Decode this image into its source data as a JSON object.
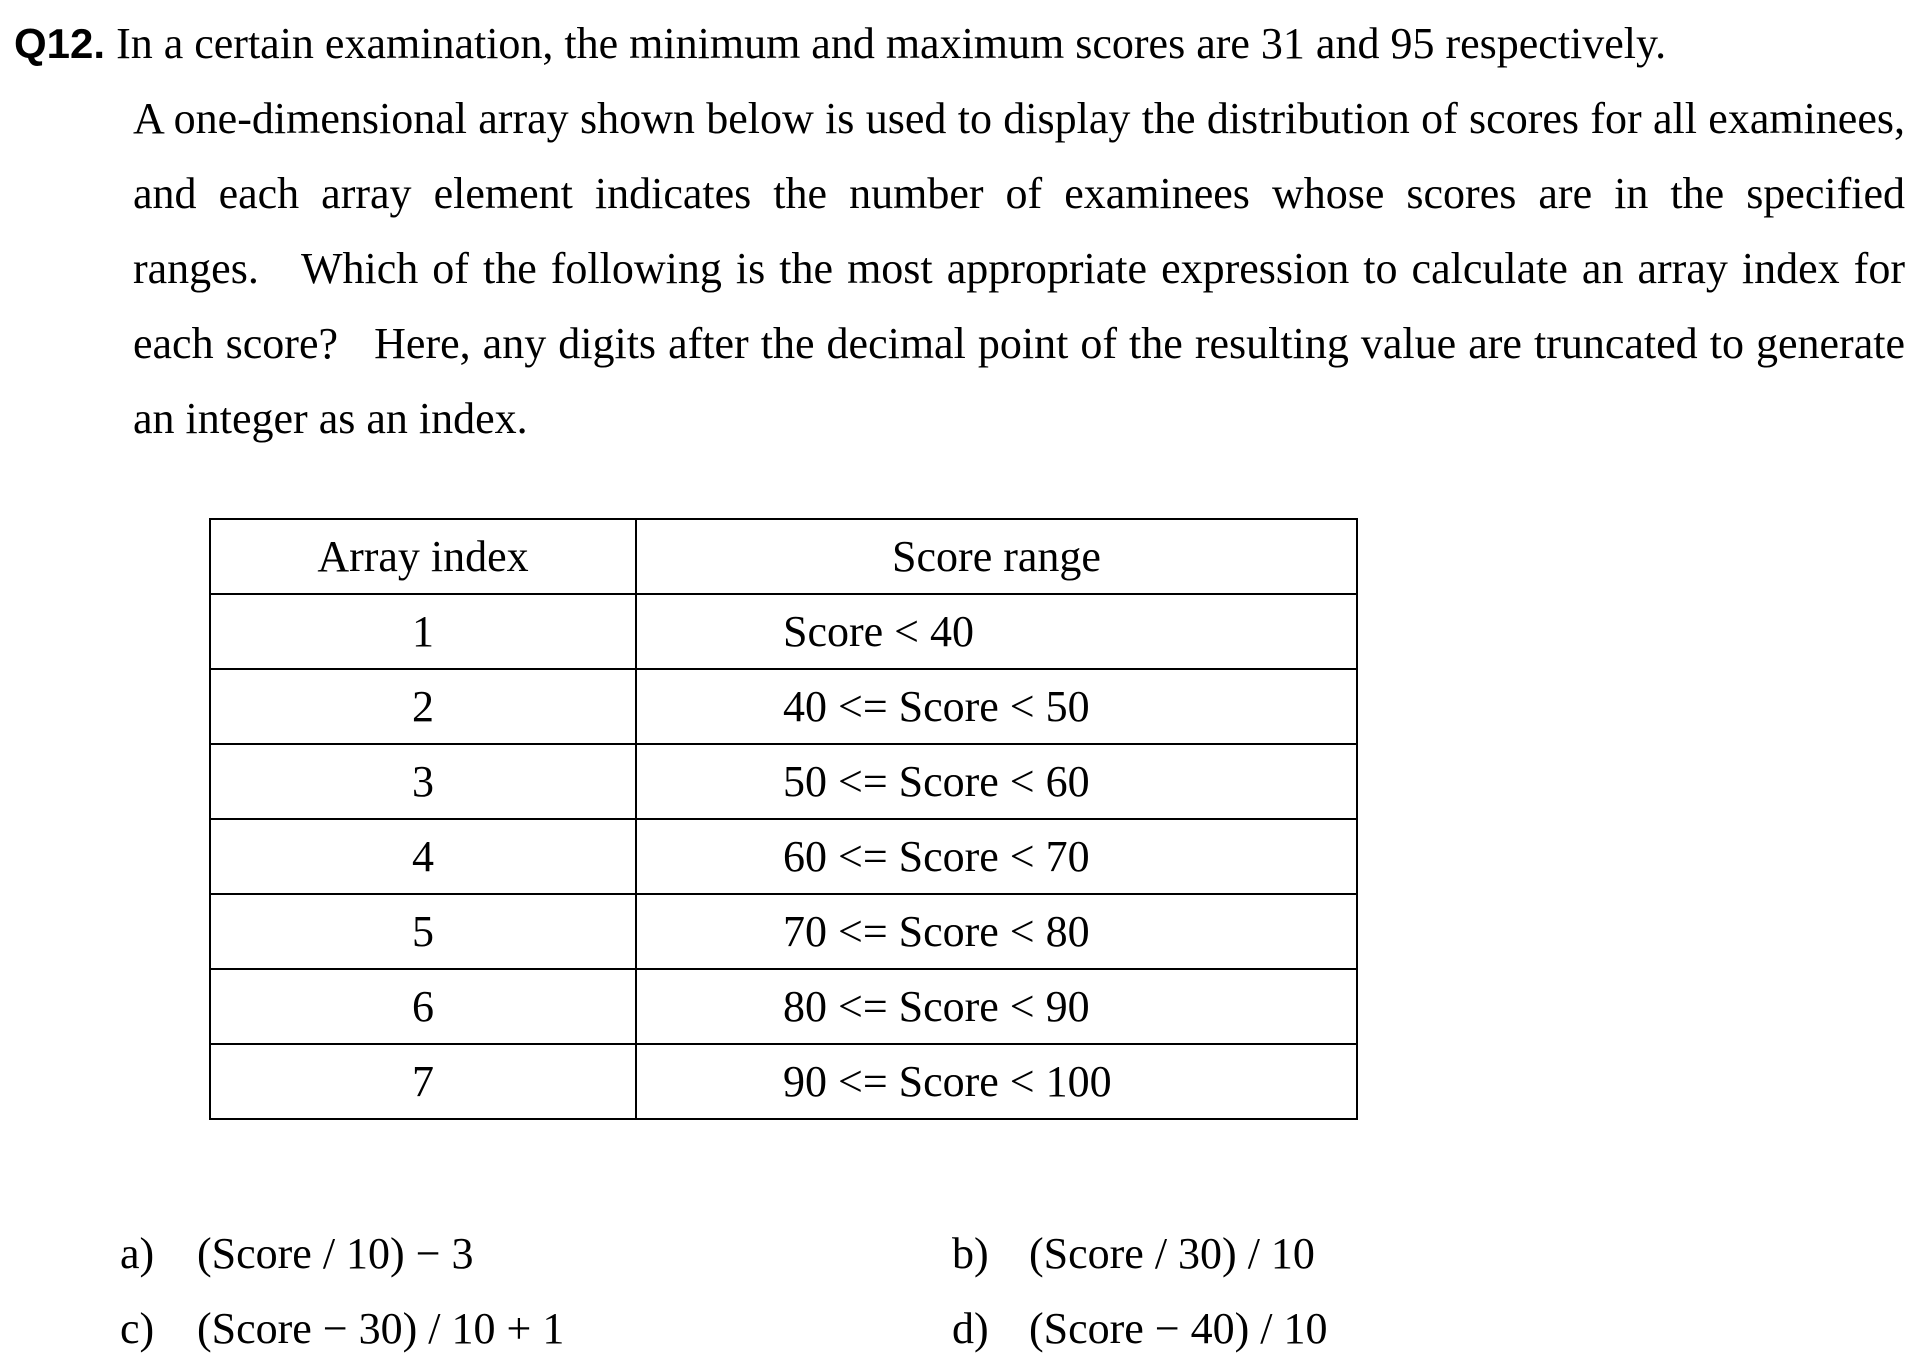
{
  "question": {
    "number": "Q12.",
    "first_line": "In a certain examination, the minimum and maximum scores are 31 and 95 respectively.",
    "body": "A one-dimensional array shown below is used to display the distribution of scores for all examinees, and each array element indicates the number of examinees whose scores are in the specified ranges.   Which of the following is the most appropriate expression to calculate an array index for each score?   Here, any digits after the decimal point of the resulting value are truncated to generate an integer as an index."
  },
  "table": {
    "headers": [
      "Array index",
      "Score range"
    ],
    "rows": [
      [
        "1",
        "Score < 40"
      ],
      [
        "2",
        "40 <= Score < 50"
      ],
      [
        "3",
        "50 <= Score < 60"
      ],
      [
        "4",
        "60 <= Score < 70"
      ],
      [
        "5",
        "70 <= Score < 80"
      ],
      [
        "6",
        "80 <= Score < 90"
      ],
      [
        "7",
        "90 <= Score < 100"
      ]
    ]
  },
  "options": [
    {
      "label": "a)",
      "text": "(Score / 10) − 3"
    },
    {
      "label": "b)",
      "text": "(Score / 30) / 10"
    },
    {
      "label": "c)",
      "text": "(Score − 30) / 10 + 1"
    },
    {
      "label": "d)",
      "text": "(Score − 40) / 10"
    }
  ]
}
